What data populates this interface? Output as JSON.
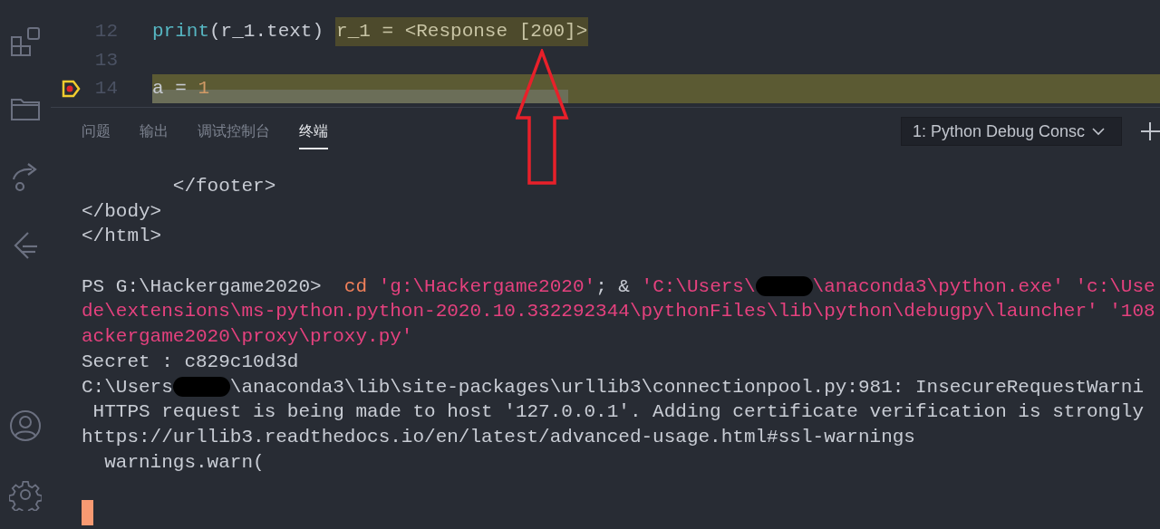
{
  "editor": {
    "lines": [
      {
        "number": "12",
        "current": false,
        "segments": [
          {
            "text": "print",
            "kind": "function"
          },
          {
            "text": "(r_1.text)",
            "kind": "plain"
          }
        ],
        "inline_value": "r_1 = <Response [200]>"
      },
      {
        "number": "13",
        "current": false
      },
      {
        "number": "14",
        "current": true,
        "segments": [
          {
            "text": "a = ",
            "kind": "plain"
          },
          {
            "text": "1",
            "kind": "number"
          }
        ]
      }
    ]
  },
  "panel": {
    "tabs": [
      {
        "label": "问题",
        "selected": false
      },
      {
        "label": "输出",
        "selected": false
      },
      {
        "label": "调试控制台",
        "selected": false
      },
      {
        "label": "终端",
        "selected": true
      }
    ],
    "terminal_selector": "1: Python Debug Consc",
    "terminal": [
      {
        "kind": "output",
        "segments": [
          {
            "text": "        </footer>",
            "kind": "plain"
          }
        ]
      },
      {
        "kind": "output",
        "segments": [
          {
            "text": "</body>",
            "kind": "plain"
          }
        ]
      },
      {
        "kind": "output",
        "segments": [
          {
            "text": "</html>",
            "kind": "plain"
          }
        ]
      },
      {
        "kind": "blank"
      },
      {
        "kind": "output",
        "segments": [
          {
            "text": "PS G:\\Hackergame2020>  ",
            "kind": "plain"
          },
          {
            "text": "cd",
            "kind": "keyword"
          },
          {
            "text": " 'g:\\Hackergame2020'",
            "kind": "string"
          },
          {
            "text": "; & ",
            "kind": "plain"
          },
          {
            "text": "'C:\\Users\\",
            "kind": "string"
          },
          {
            "kind": "redacted"
          },
          {
            "text": "\\anaconda3\\python.exe' 'c:\\Use",
            "kind": "string"
          }
        ]
      },
      {
        "kind": "output",
        "segments": [
          {
            "text": "de\\extensions\\ms-python.python-2020.10.332292344\\pythonFiles\\lib\\python\\debugpy\\launcher' '108",
            "kind": "string"
          }
        ]
      },
      {
        "kind": "output",
        "segments": [
          {
            "text": "ackergame2020\\proxy\\proxy.py'",
            "kind": "string"
          }
        ]
      },
      {
        "kind": "output",
        "segments": [
          {
            "text": "Secret : c829c10d3d",
            "kind": "plain"
          }
        ]
      },
      {
        "kind": "output",
        "segments": [
          {
            "text": "C:\\Users",
            "kind": "plain"
          },
          {
            "kind": "redacted"
          },
          {
            "text": "\\anaconda3\\lib\\site-packages\\urllib3\\connectionpool.py:981: InsecureRequestWarni",
            "kind": "plain"
          }
        ]
      },
      {
        "kind": "output",
        "segments": [
          {
            "text": " HTTPS request is being made to host '127.0.0.1'. Adding certificate verification is strongly",
            "kind": "plain"
          }
        ]
      },
      {
        "kind": "output",
        "segments": [
          {
            "text": "https://urllib3.readthedocs.io/en/latest/advanced-usage.html#ssl-warnings",
            "kind": "plain"
          }
        ]
      },
      {
        "kind": "output",
        "segments": [
          {
            "text": "  warnings.warn(",
            "kind": "plain"
          }
        ]
      },
      {
        "kind": "blank"
      }
    ]
  }
}
